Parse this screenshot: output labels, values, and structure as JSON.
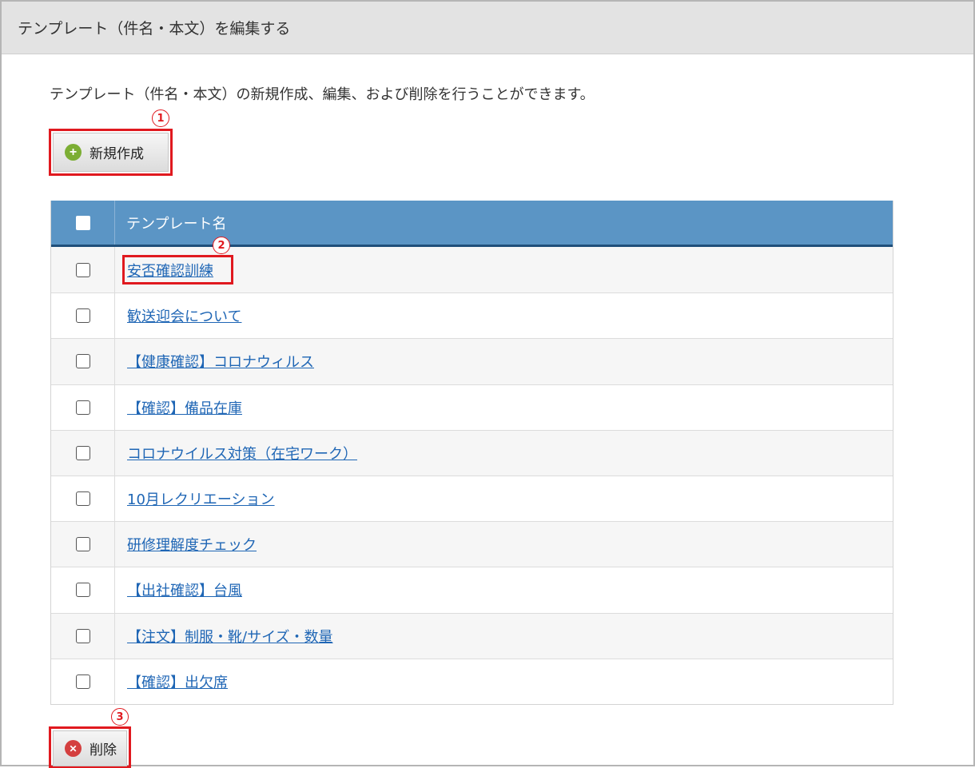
{
  "header": {
    "title": "テンプレート（件名・本文）を編集する"
  },
  "description": "テンプレート（件名・本文）の新規作成、編集、および削除を行うことができます。",
  "new_button": {
    "label": "新規作成",
    "icon": "plus-circle-icon",
    "color": "#7cae34"
  },
  "delete_button": {
    "label": "削除",
    "icon": "close-circle-icon",
    "color": "#d43f3f"
  },
  "callouts": {
    "marker1": "1",
    "marker2": "2",
    "marker3": "3",
    "color": "#e0191f"
  },
  "table": {
    "header_color": "#5b95c5",
    "column_header": "テンプレート名",
    "rows": [
      "安否確認訓練",
      "歓送迎会について",
      "【健康確認】コロナウィルス",
      "【確認】備品在庫",
      "コロナウイルス対策（在宅ワーク）",
      "10月レクリエーション",
      "研修理解度チェック",
      "【出社確認】台風",
      "【注文】制服・靴/サイズ・数量",
      "【確認】出欠席"
    ]
  }
}
